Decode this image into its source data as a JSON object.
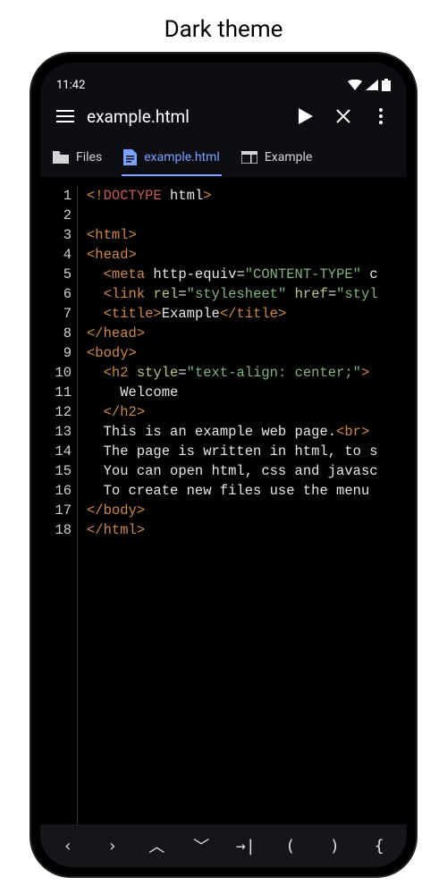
{
  "page_title": "Dark theme",
  "status": {
    "time": "11:42"
  },
  "appbar": {
    "title": "example.html"
  },
  "tabs": [
    {
      "icon": "folder",
      "label": "Files",
      "active": false
    },
    {
      "icon": "file",
      "label": "example.html",
      "active": true
    },
    {
      "icon": "web",
      "label": "Example",
      "active": false
    }
  ],
  "numbers": [
    "1",
    "2",
    "3",
    "4",
    "5",
    "6",
    "7",
    "8",
    "9",
    "10",
    "11",
    "12",
    "13",
    "14",
    "15",
    "16",
    "17",
    "18"
  ],
  "code": [
    [
      {
        "c": "c-tag",
        "t": "<!"
      },
      {
        "c": "c-red",
        "t": "DOCTYPE"
      },
      {
        "c": "c-txt",
        "t": " html"
      },
      {
        "c": "c-tag",
        "t": ">"
      }
    ],
    [],
    [
      {
        "c": "c-tag",
        "t": "<html>"
      }
    ],
    [
      {
        "c": "c-tag",
        "t": "<head>"
      }
    ],
    [
      {
        "c": "c-txt",
        "t": "  "
      },
      {
        "c": "c-tag",
        "t": "<meta"
      },
      {
        "c": "c-txt",
        "t": " http-equiv="
      },
      {
        "c": "c-str",
        "t": "\"CONTENT-TYPE\""
      },
      {
        "c": "c-txt",
        "t": " c"
      }
    ],
    [
      {
        "c": "c-txt",
        "t": "  "
      },
      {
        "c": "c-tag",
        "t": "<link"
      },
      {
        "c": "c-txt",
        "t": " "
      },
      {
        "c": "c-key",
        "t": "rel"
      },
      {
        "c": "c-txt",
        "t": "="
      },
      {
        "c": "c-str",
        "t": "\"stylesheet\""
      },
      {
        "c": "c-txt",
        "t": " "
      },
      {
        "c": "c-key",
        "t": "href"
      },
      {
        "c": "c-txt",
        "t": "="
      },
      {
        "c": "c-str",
        "t": "\"styl"
      }
    ],
    [
      {
        "c": "c-txt",
        "t": "  "
      },
      {
        "c": "c-tag",
        "t": "<title>"
      },
      {
        "c": "c-txt",
        "t": "Example"
      },
      {
        "c": "c-tag",
        "t": "</title>"
      }
    ],
    [
      {
        "c": "c-tag",
        "t": "</head>"
      }
    ],
    [
      {
        "c": "c-tag",
        "t": "<body>"
      }
    ],
    [
      {
        "c": "c-txt",
        "t": "  "
      },
      {
        "c": "c-tag",
        "t": "<h2"
      },
      {
        "c": "c-txt",
        "t": " "
      },
      {
        "c": "c-key",
        "t": "style"
      },
      {
        "c": "c-txt",
        "t": "="
      },
      {
        "c": "c-str",
        "t": "\"text-align: center;\""
      },
      {
        "c": "c-tag",
        "t": ">"
      }
    ],
    [
      {
        "c": "c-txt",
        "t": "    Welcome"
      }
    ],
    [
      {
        "c": "c-txt",
        "t": "  "
      },
      {
        "c": "c-tag",
        "t": "</h2>"
      }
    ],
    [
      {
        "c": "c-txt",
        "t": "  This is an example web page."
      },
      {
        "c": "c-tag",
        "t": "<br>"
      }
    ],
    [
      {
        "c": "c-txt",
        "t": "  The page is written in html, to s"
      }
    ],
    [
      {
        "c": "c-txt",
        "t": "  You can open html, css and javasc"
      }
    ],
    [
      {
        "c": "c-txt",
        "t": "  To create new files use the menu "
      }
    ],
    [
      {
        "c": "c-tag",
        "t": "</body>"
      }
    ],
    [
      {
        "c": "c-tag",
        "t": "</html>"
      }
    ]
  ],
  "bottom": {
    "b0": "‹",
    "b1": "›",
    "b2": "︿",
    "b3": "﹀",
    "b4": "→|",
    "b5": "(",
    "b6": ")",
    "b7": "{"
  }
}
